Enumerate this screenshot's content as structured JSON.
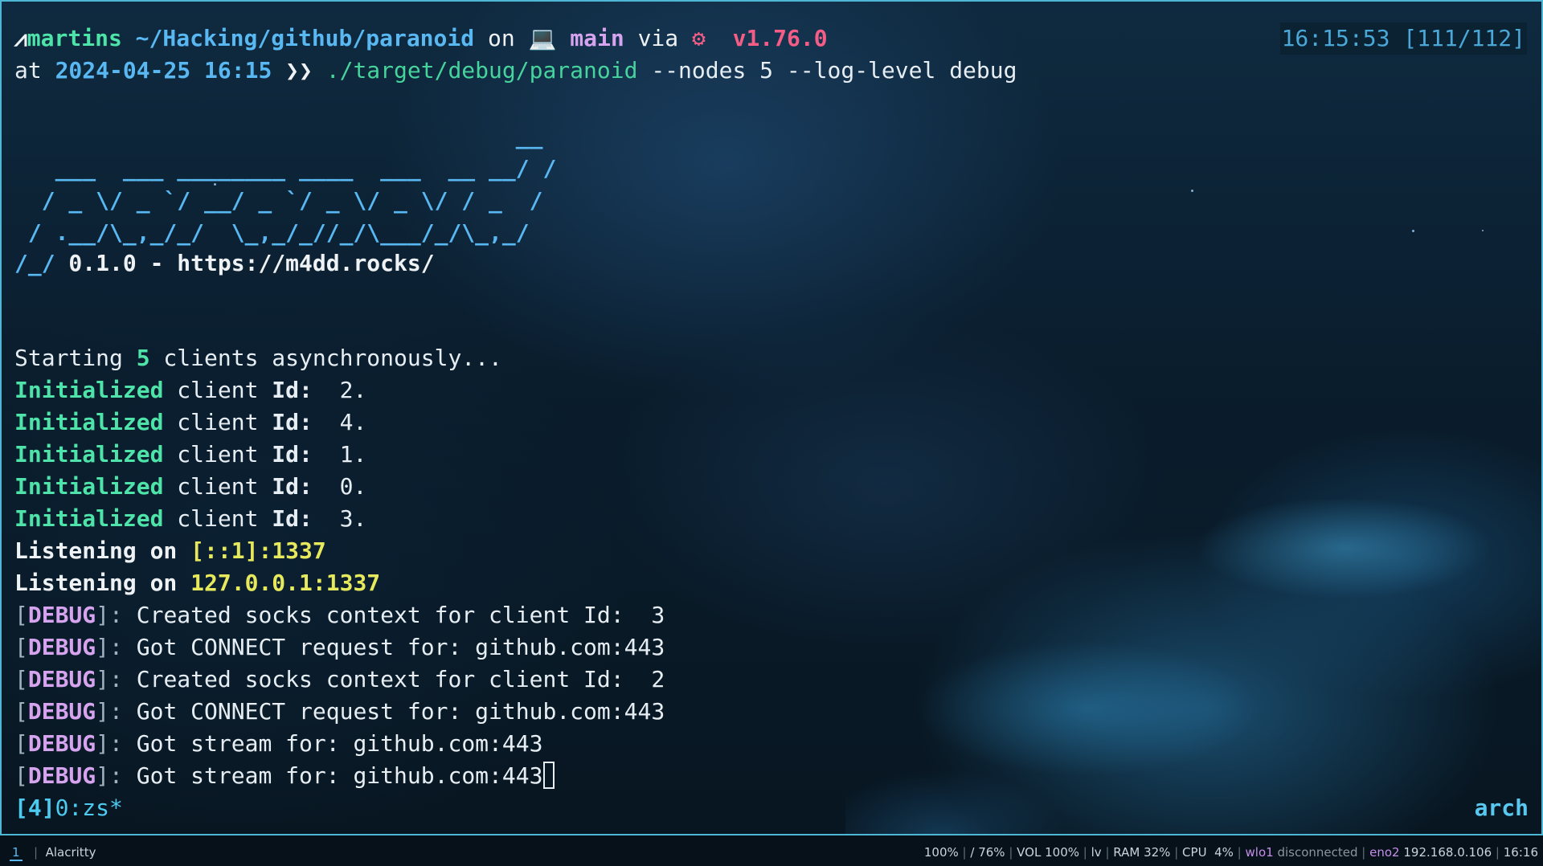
{
  "prompt": {
    "user": "martins",
    "path": "~/Hacking/github/paranoid",
    "on": "on",
    "branch": "main",
    "via": "via",
    "rust_icon": "⚙",
    "version": "v1.76.0",
    "at": "at",
    "datetime": "2024-04-25 16:15",
    "arrow": "❯❯",
    "command_path": "./target/debug/paranoid",
    "command_args": " --nodes 5 --log-level debug"
  },
  "clock": "16:15:53 [111/112]",
  "banner": {
    "line1": "                                     __",
    "line2": "   ___  ___ ________ ____  ___  __ __/ /",
    "line3": "  / _ \\/ _ `/ __/ _ `/ _ \\/ _ \\/ / _  /",
    "line4": " / .__/\\_,_/_/  \\_,_/_//_/\\___/_/\\_,_/",
    "line5_prefix": "/_/",
    "line5_text": " 0.1.0 - https://m4dd.rocks/"
  },
  "output": {
    "starting_prefix": "Starting ",
    "starting_count": "5",
    "starting_suffix": " clients asynchronously...",
    "init_word": "Initialized",
    "client_word": " client ",
    "id_word": "Id:",
    "init_ids": [
      "2",
      "4",
      "1",
      "0",
      "3"
    ],
    "listening_word": "Listening on ",
    "listen1": "[::1]:1337",
    "listen2": "127.0.0.1:1337",
    "debug_tag": "DEBUG",
    "debug_lines": [
      "Created socks context for client Id:  3",
      "Got CONNECT request for: github.com:443",
      "Created socks context for client Id:  2",
      "Got CONNECT request for: github.com:443",
      "Got stream for: github.com:443",
      "Got stream for: github.com:443"
    ]
  },
  "tmux": {
    "session": "[4]",
    "window": "0:zs*",
    "host": "arch"
  },
  "statusbar": {
    "workspace": "1",
    "window_title": "Alacritty",
    "brightness": "100%",
    "disk": "/ 76%",
    "vol": "VOL 100%",
    "lv": "lv",
    "ram": "RAM 32%",
    "cpu": "CPU  4%",
    "wifi_iface": "wlo1",
    "wifi_status": "disconnected",
    "eth_iface": "eno2",
    "eth_ip": "192.168.0.106",
    "time": "16:16"
  }
}
